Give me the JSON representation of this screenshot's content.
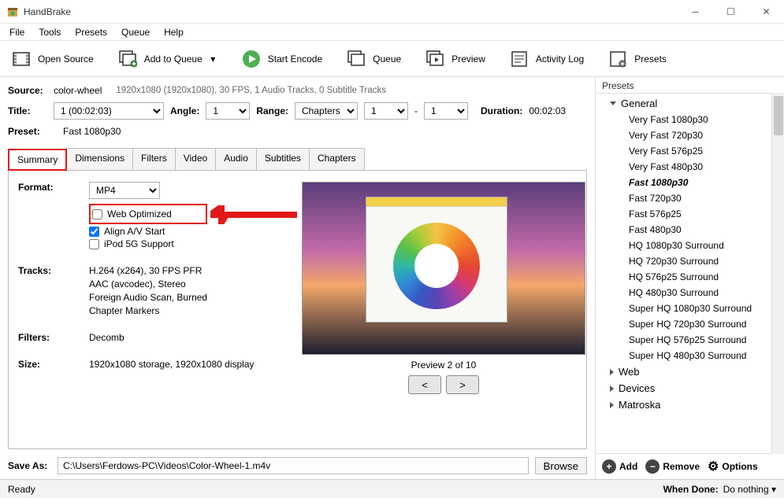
{
  "title": "HandBrake",
  "menu": [
    "File",
    "Tools",
    "Presets",
    "Queue",
    "Help"
  ],
  "toolbar": {
    "open": "Open Source",
    "addq": "Add to Queue",
    "start": "Start Encode",
    "queue": "Queue",
    "preview": "Preview",
    "activity": "Activity Log",
    "presets": "Presets"
  },
  "source": {
    "lbl": "Source:",
    "name": "color-wheel",
    "info": "1920x1080 (1920x1080), 30 FPS, 1 Audio Tracks, 0 Subtitle Tracks"
  },
  "titleRow": {
    "lbl": "Title:",
    "val": "1  (00:02:03)",
    "angleLbl": "Angle:",
    "angle": "1",
    "rangeLbl": "Range:",
    "range": "Chapters",
    "r1": "1",
    "dash": "-",
    "r2": "1",
    "durLbl": "Duration:",
    "dur": "00:02:03"
  },
  "preset": {
    "lbl": "Preset:",
    "val": "Fast 1080p30"
  },
  "tabs": [
    "Summary",
    "Dimensions",
    "Filters",
    "Video",
    "Audio",
    "Subtitles",
    "Chapters"
  ],
  "format": {
    "lbl": "Format:",
    "val": "MP4"
  },
  "checks": {
    "web": "Web Optimized",
    "av": "Align A/V Start",
    "ipod": "iPod 5G Support"
  },
  "tracks": {
    "lbl": "Tracks:",
    "l1": "H.264 (x264), 30 FPS PFR",
    "l2": "AAC (avcodec), Stereo",
    "l3": "Foreign Audio Scan, Burned",
    "l4": "Chapter Markers"
  },
  "filters": {
    "lbl": "Filters:",
    "val": "Decomb"
  },
  "size": {
    "lbl": "Size:",
    "val": "1920x1080 storage, 1920x1080 display"
  },
  "previewLabel": "Preview 2 of 10",
  "prev": "<",
  "next": ">",
  "presetsPane": {
    "hdr": "Presets",
    "general": "General",
    "generalItems": [
      "Very Fast 1080p30",
      "Very Fast 720p30",
      "Very Fast 576p25",
      "Very Fast 480p30",
      "Fast 1080p30",
      "Fast 720p30",
      "Fast 576p25",
      "Fast 480p30",
      "HQ 1080p30 Surround",
      "HQ 720p30 Surround",
      "HQ 576p25 Surround",
      "HQ 480p30 Surround",
      "Super HQ 1080p30 Surround",
      "Super HQ 720p30 Surround",
      "Super HQ 576p25 Surround",
      "Super HQ 480p30 Surround"
    ],
    "web": "Web",
    "devices": "Devices",
    "matroska": "Matroska",
    "add": "Add",
    "remove": "Remove",
    "options": "Options"
  },
  "saveAs": {
    "lbl": "Save As:",
    "path": "C:\\Users\\Ferdows-PC\\Videos\\Color-Wheel-1.m4v",
    "browse": "Browse"
  },
  "status": {
    "ready": "Ready",
    "whenLbl": "When Done:",
    "whenVal": "Do nothing"
  }
}
